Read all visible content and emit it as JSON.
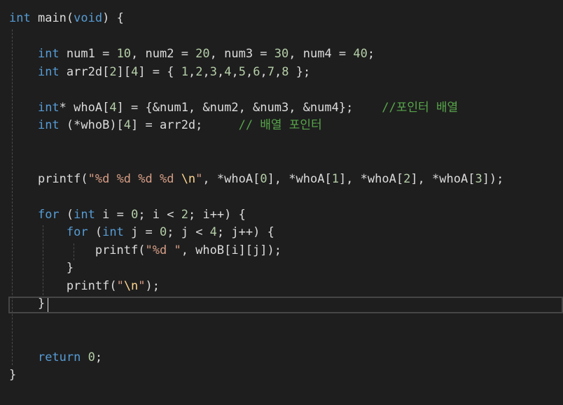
{
  "editor": {
    "lines": [
      {
        "tokens": [
          [
            "kw",
            "int"
          ],
          [
            "pl",
            " "
          ],
          [
            "fn",
            "main"
          ],
          [
            "pl",
            "("
          ],
          [
            "kw",
            "void"
          ],
          [
            "pl",
            ") {"
          ]
        ]
      },
      {
        "tokens": []
      },
      {
        "tokens": [
          [
            "pl",
            "    "
          ],
          [
            "kw",
            "int"
          ],
          [
            "pl",
            " num1 = "
          ],
          [
            "nm",
            "10"
          ],
          [
            "pl",
            ", num2 = "
          ],
          [
            "nm",
            "20"
          ],
          [
            "pl",
            ", num3 = "
          ],
          [
            "nm",
            "30"
          ],
          [
            "pl",
            ", num4 = "
          ],
          [
            "nm",
            "40"
          ],
          [
            "pl",
            ";"
          ]
        ]
      },
      {
        "tokens": [
          [
            "pl",
            "    "
          ],
          [
            "kw",
            "int"
          ],
          [
            "pl",
            " arr2d["
          ],
          [
            "nm",
            "2"
          ],
          [
            "pl",
            "]["
          ],
          [
            "nm",
            "4"
          ],
          [
            "pl",
            "] = { "
          ],
          [
            "nm",
            "1"
          ],
          [
            "pl",
            ","
          ],
          [
            "nm",
            "2"
          ],
          [
            "pl",
            ","
          ],
          [
            "nm",
            "3"
          ],
          [
            "pl",
            ","
          ],
          [
            "nm",
            "4"
          ],
          [
            "pl",
            ","
          ],
          [
            "nm",
            "5"
          ],
          [
            "pl",
            ","
          ],
          [
            "nm",
            "6"
          ],
          [
            "pl",
            ","
          ],
          [
            "nm",
            "7"
          ],
          [
            "pl",
            ","
          ],
          [
            "nm",
            "8"
          ],
          [
            "pl",
            " };"
          ]
        ]
      },
      {
        "tokens": []
      },
      {
        "tokens": [
          [
            "pl",
            "    "
          ],
          [
            "kw",
            "int"
          ],
          [
            "pl",
            "* whoA["
          ],
          [
            "nm",
            "4"
          ],
          [
            "pl",
            "] = {&num1, &num2, &num3, &num4};    "
          ],
          [
            "cm",
            "//포인터 배열"
          ]
        ]
      },
      {
        "tokens": [
          [
            "pl",
            "    "
          ],
          [
            "kw",
            "int"
          ],
          [
            "pl",
            " (*whoB)["
          ],
          [
            "nm",
            "4"
          ],
          [
            "pl",
            "] = arr2d;     "
          ],
          [
            "cm",
            "// 배열 포인터"
          ]
        ]
      },
      {
        "tokens": []
      },
      {
        "tokens": []
      },
      {
        "tokens": [
          [
            "pl",
            "    "
          ],
          [
            "fn",
            "printf"
          ],
          [
            "pl",
            "("
          ],
          [
            "st",
            "\"%d %d %d %d "
          ],
          [
            "es",
            "\\n"
          ],
          [
            "st",
            "\""
          ],
          [
            "pl",
            ", *whoA["
          ],
          [
            "nm",
            "0"
          ],
          [
            "pl",
            "], *whoA["
          ],
          [
            "nm",
            "1"
          ],
          [
            "pl",
            "], *whoA["
          ],
          [
            "nm",
            "2"
          ],
          [
            "pl",
            "], *whoA["
          ],
          [
            "nm",
            "3"
          ],
          [
            "pl",
            "]);"
          ]
        ]
      },
      {
        "tokens": []
      },
      {
        "tokens": [
          [
            "pl",
            "    "
          ],
          [
            "kw",
            "for"
          ],
          [
            "pl",
            " ("
          ],
          [
            "kw",
            "int"
          ],
          [
            "pl",
            " i = "
          ],
          [
            "nm",
            "0"
          ],
          [
            "pl",
            "; i < "
          ],
          [
            "nm",
            "2"
          ],
          [
            "pl",
            "; i++) {"
          ]
        ]
      },
      {
        "tokens": [
          [
            "pl",
            "        "
          ],
          [
            "kw",
            "for"
          ],
          [
            "pl",
            " ("
          ],
          [
            "kw",
            "int"
          ],
          [
            "pl",
            " j = "
          ],
          [
            "nm",
            "0"
          ],
          [
            "pl",
            "; j < "
          ],
          [
            "nm",
            "4"
          ],
          [
            "pl",
            "; j++) {"
          ]
        ]
      },
      {
        "tokens": [
          [
            "pl",
            "            "
          ],
          [
            "fn",
            "printf"
          ],
          [
            "pl",
            "("
          ],
          [
            "st",
            "\"%d \""
          ],
          [
            "pl",
            ", whoB[i][j]);"
          ]
        ]
      },
      {
        "tokens": [
          [
            "pl",
            "        }"
          ]
        ]
      },
      {
        "tokens": [
          [
            "pl",
            "        "
          ],
          [
            "fn",
            "printf"
          ],
          [
            "pl",
            "("
          ],
          [
            "st",
            "\""
          ],
          [
            "es",
            "\\n"
          ],
          [
            "st",
            "\""
          ],
          [
            "pl",
            ");"
          ]
        ]
      },
      {
        "tokens": [
          [
            "pl",
            "    }"
          ]
        ]
      },
      {
        "tokens": []
      },
      {
        "tokens": []
      },
      {
        "tokens": [
          [
            "pl",
            "    "
          ],
          [
            "kw",
            "return"
          ],
          [
            "pl",
            " "
          ],
          [
            "nm",
            "0"
          ],
          [
            "pl",
            ";"
          ]
        ]
      },
      {
        "tokens": [
          [
            "pl",
            "}"
          ]
        ]
      }
    ],
    "colors": {
      "background": "#1e1e1e",
      "keyword": "#569cd6",
      "plain": "#dcdcdc",
      "number": "#b5cea8",
      "string": "#d69d85",
      "escape": "#ffd68f",
      "comment": "#57a64a",
      "current_line_border": "#464646"
    }
  }
}
